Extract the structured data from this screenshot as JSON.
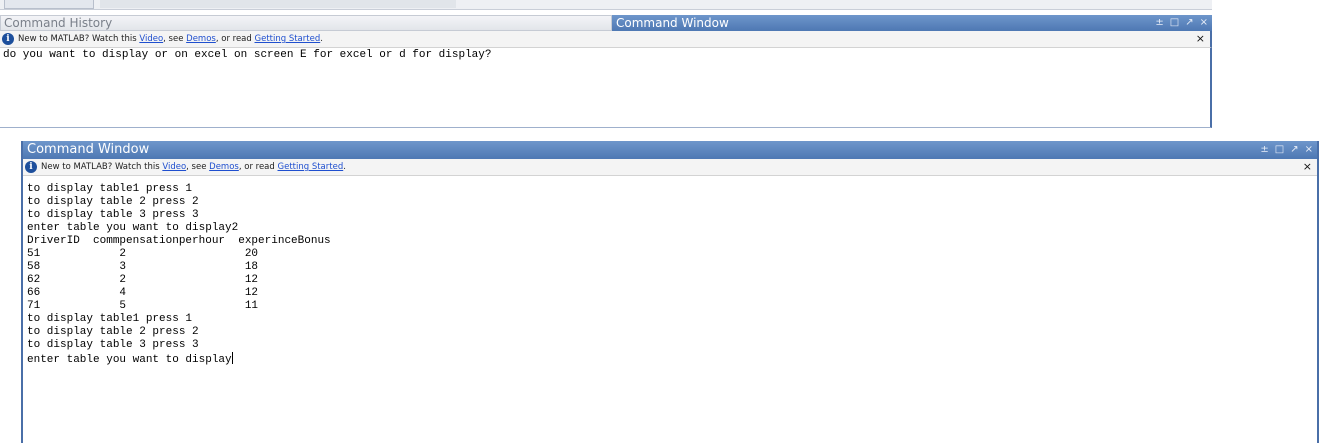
{
  "history_panel": {
    "title": "Command History"
  },
  "top_command_window": {
    "title": "Command Window",
    "info": {
      "prefix": "New to MATLAB? Watch this ",
      "video_link": "Video",
      "sep1": ", see ",
      "demos_link": "Demos",
      "sep2": ", or read ",
      "getting_started_link": "Getting Started",
      "suffix": "."
    },
    "close_glyph": "×",
    "lines": [
      "do you want to display or on excel on screen E for excel or d for display?"
    ]
  },
  "bottom_command_window": {
    "title": "Command Window",
    "info": {
      "prefix": "New to MATLAB? Watch this ",
      "video_link": "Video",
      "sep1": ", see ",
      "demos_link": "Demos",
      "sep2": ", or read ",
      "getting_started_link": "Getting Started",
      "suffix": "."
    },
    "close_glyph": "×",
    "lines": [
      "to display table1 press 1",
      "to display table 2 press 2",
      "to display table 3 press 3",
      "enter table you want to display2",
      "DriverID  commpensationperhour  experinceBonus",
      "51            2                  20",
      "58            3                  18",
      "62            2                  12",
      "66            4                  12",
      "71            5                  11",
      "to display table1 press 1",
      "to display table 2 press 2",
      "to display table 3 press 3"
    ],
    "prompt_line": "enter table you want to display"
  },
  "window_controls": {
    "undock": "±",
    "maximize": "□",
    "pin": "↗",
    "close": "×"
  },
  "icons": {
    "info": "i"
  },
  "colors": {
    "header_blue": "#5a82bd",
    "link_blue": "#1f4fcf",
    "info_icon": "#1d4f9c"
  }
}
